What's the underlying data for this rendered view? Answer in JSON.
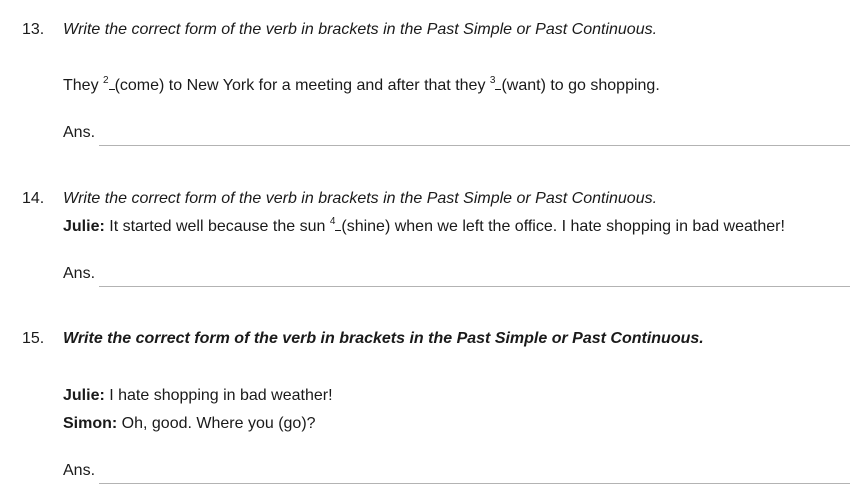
{
  "questions": [
    {
      "number": "13.",
      "instruction": "Write the correct form of the verb in brackets in the Past Simple or Past Continuous.",
      "text": {
        "a": "They ",
        "sup1": "2",
        "b": "(come) to New York for a meeting and after that they ",
        "sup2": "3",
        "c": "(want) to go shopping."
      },
      "answer_label": "Ans."
    },
    {
      "number": "14.",
      "instruction": "Write the correct form of the verb in brackets in the Past Simple or Past Continuous.",
      "text": {
        "speaker": "Julie:",
        "a": " It started well because the sun ",
        "sup1": "4",
        "b": "(shine) when we left the office. I hate shopping in bad weather!"
      },
      "answer_label": "Ans."
    },
    {
      "number": "15.",
      "instruction": "Write the correct form of the verb in brackets in the Past Simple or Past Continuous.",
      "lines": [
        {
          "speaker": "Julie:",
          "text": " I hate shopping in bad weather!"
        },
        {
          "speaker": "Simon:",
          "text": " Oh, good. Where you (go)?"
        }
      ],
      "answer_label": "Ans."
    }
  ]
}
